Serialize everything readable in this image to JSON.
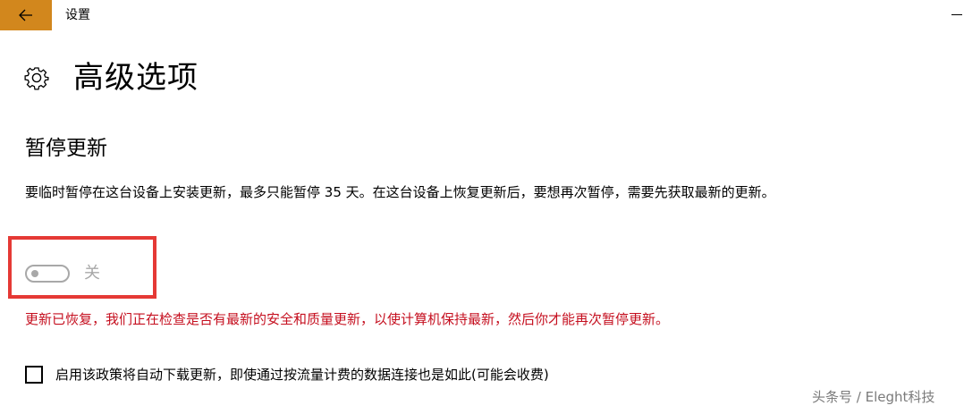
{
  "window": {
    "title": "设置",
    "accent_color": "#d2871d"
  },
  "icons": {
    "back": "back-arrow-icon",
    "settings": "gear-icon",
    "minimize": "minimize-icon"
  },
  "header": {
    "title": "高级选项"
  },
  "pause_updates": {
    "section_title": "暂停更新",
    "description": "要临时暂停在这台设备上安装更新，最多只能暂停 35 天。在这台设备上恢复更新后，要想再次暂停，需要先获取最新的更新。",
    "toggle": {
      "state": "off",
      "label": "关",
      "disabled": true
    },
    "highlight_color": "#e53935",
    "status_message": "更新已恢复，我们正在检查是否有最新的安全和质量更新，以使计算机保持最新，然后你才能再次暂停更新。",
    "status_color": "#c50f1f"
  },
  "metered_option": {
    "checked": false,
    "label": "启用该政策将自动下载更新，即使通过按流量计费的数据连接也是如此(可能会收费)"
  },
  "watermark": {
    "text": "头条号 / Eleght科技"
  }
}
